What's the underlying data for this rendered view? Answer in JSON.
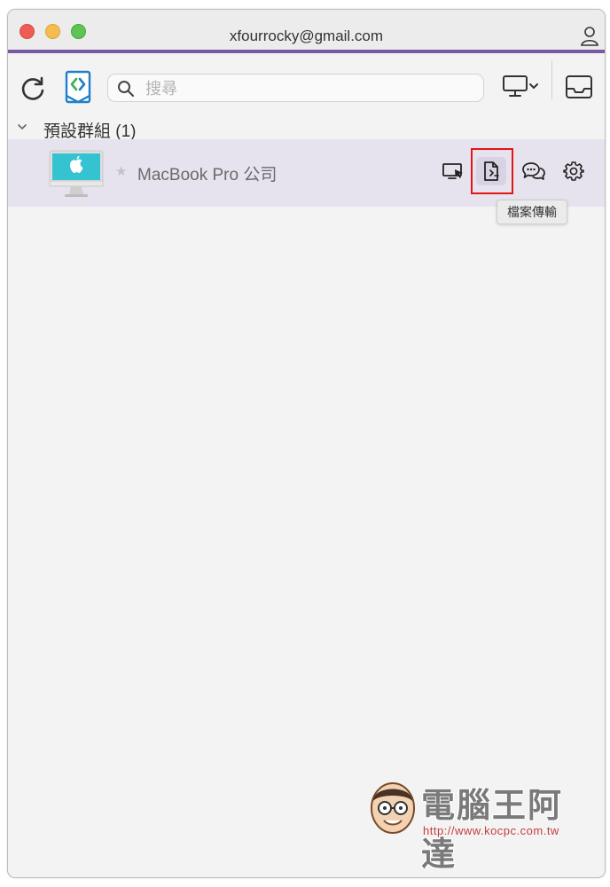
{
  "window": {
    "title": "xfourrocky@gmail.com"
  },
  "toolbar": {
    "search_placeholder": "搜尋",
    "search_value": ""
  },
  "group": {
    "label": "預設群組 (1)"
  },
  "device": {
    "name": "MacBook Pro 公司",
    "actions": [
      "remote-control",
      "file-transfer",
      "chat",
      "settings"
    ]
  },
  "tooltip": {
    "text": "檔案傳輸"
  },
  "watermark": {
    "title": "電腦王阿達",
    "url": "http://www.kocpc.com.tw"
  },
  "colors": {
    "accent": "#7a58a6",
    "brand_blue": "#1f7ec9",
    "brand_green": "#38b24a",
    "selected_row": "#e6e3ee",
    "highlight": "#e41515"
  }
}
